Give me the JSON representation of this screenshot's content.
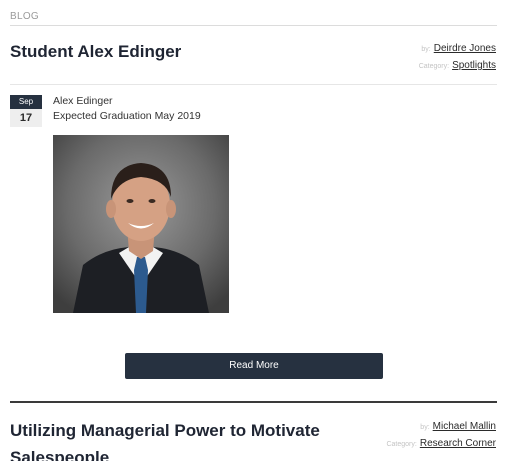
{
  "section": {
    "label": "BLOG"
  },
  "posts": [
    {
      "title": "Student Alex Edinger",
      "author_label": "by:",
      "author": "Deirdre Jones",
      "category_label": "Category:",
      "category": "Spotlights",
      "date": {
        "month": "Sep",
        "day": "17"
      },
      "body": [
        "Alex Edinger",
        "Expected Graduation May 2019"
      ],
      "read_more_label": "Read More"
    },
    {
      "title": "Utilizing Managerial Power to Motivate Salespeople",
      "author_label": "by:",
      "author": "Michael Mallin",
      "category_label": "Category:",
      "category": "Research Corner"
    }
  ],
  "colors": {
    "accent": "#263140",
    "text": "#2b2b2b",
    "muted": "#9a9a9a"
  }
}
